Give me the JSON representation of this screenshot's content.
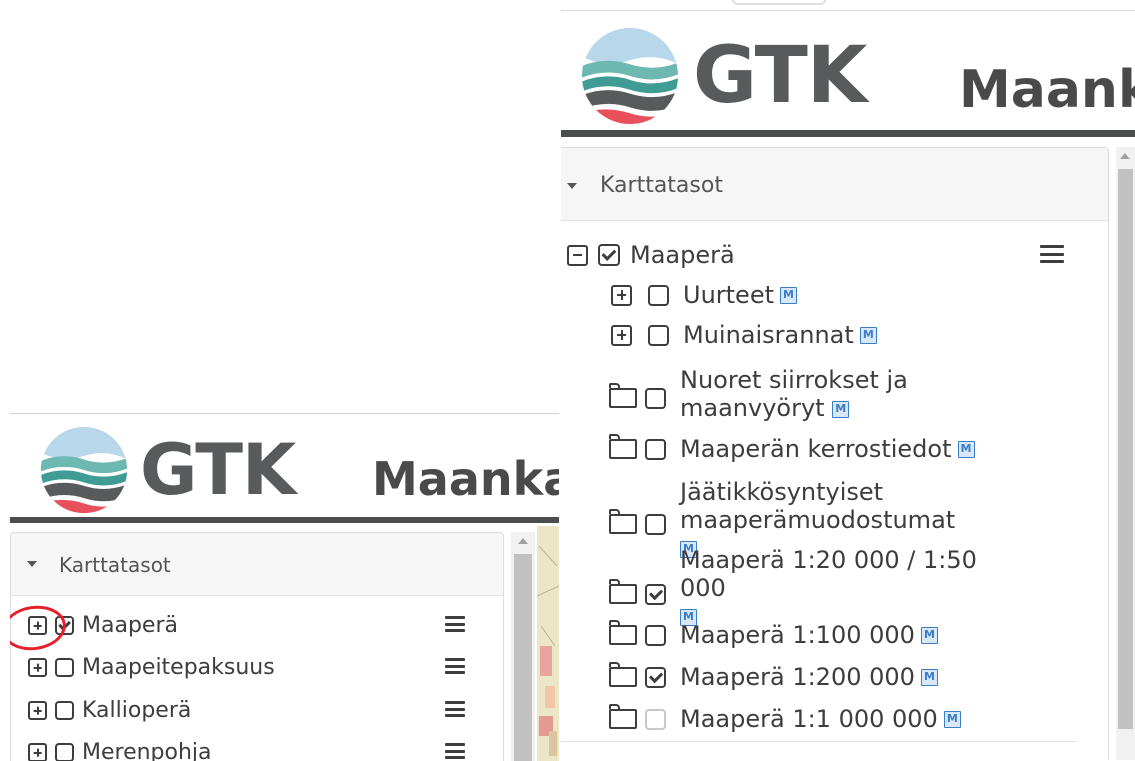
{
  "brand": {
    "logo_text": "GTK",
    "title_partial_left": "Maanka",
    "title_partial_right": "Maank"
  },
  "colors": {
    "accent": "#3b7ec8",
    "annotation": "#e5202b",
    "logo_teal": "#3f9c94",
    "logo_blue": "#9fc5e0",
    "logo_red": "#e8505b",
    "logo_gray": "#585a5c"
  },
  "left": {
    "section_header": "Karttatasot",
    "layers": [
      {
        "label": "Maaperä",
        "expander": "plus",
        "checked": true
      },
      {
        "label": "Maapeitepaksuus",
        "expander": "plus",
        "checked": false
      },
      {
        "label": "Kallioperä",
        "expander": "plus",
        "checked": false
      },
      {
        "label": "Merenpohja",
        "expander": "plus",
        "checked": false
      }
    ]
  },
  "right": {
    "section_header": "Karttatasot",
    "parent": {
      "label": "Maaperä",
      "expander": "minus",
      "checked": true
    },
    "children": [
      {
        "label": "Uurteet",
        "type": "group",
        "checked": false,
        "meta": "M"
      },
      {
        "label": "Muinaisrannat",
        "type": "group",
        "checked": false,
        "meta": "M"
      },
      {
        "label": "Nuoret siirrokset ja maanvyöryt",
        "type": "folder",
        "checked": false,
        "meta": "M"
      },
      {
        "label": "Maaperän kerrostiedot",
        "type": "folder",
        "checked": false,
        "meta": "M"
      },
      {
        "label": "Jäätikkösyntyiset maaperämuodostumat",
        "type": "folder",
        "checked": false,
        "meta": "M"
      },
      {
        "label": "Maaperä 1:20 000 / 1:50 000",
        "type": "folder",
        "checked": true,
        "meta": "M"
      },
      {
        "label": "Maaperä 1:100 000",
        "type": "folder",
        "checked": false,
        "meta": "M"
      },
      {
        "label": "Maaperä 1:200 000",
        "type": "folder",
        "checked": true,
        "meta": "M"
      },
      {
        "label": "Maaperä 1:1 000 000",
        "type": "folder",
        "checked": false,
        "meta": "M"
      }
    ]
  }
}
